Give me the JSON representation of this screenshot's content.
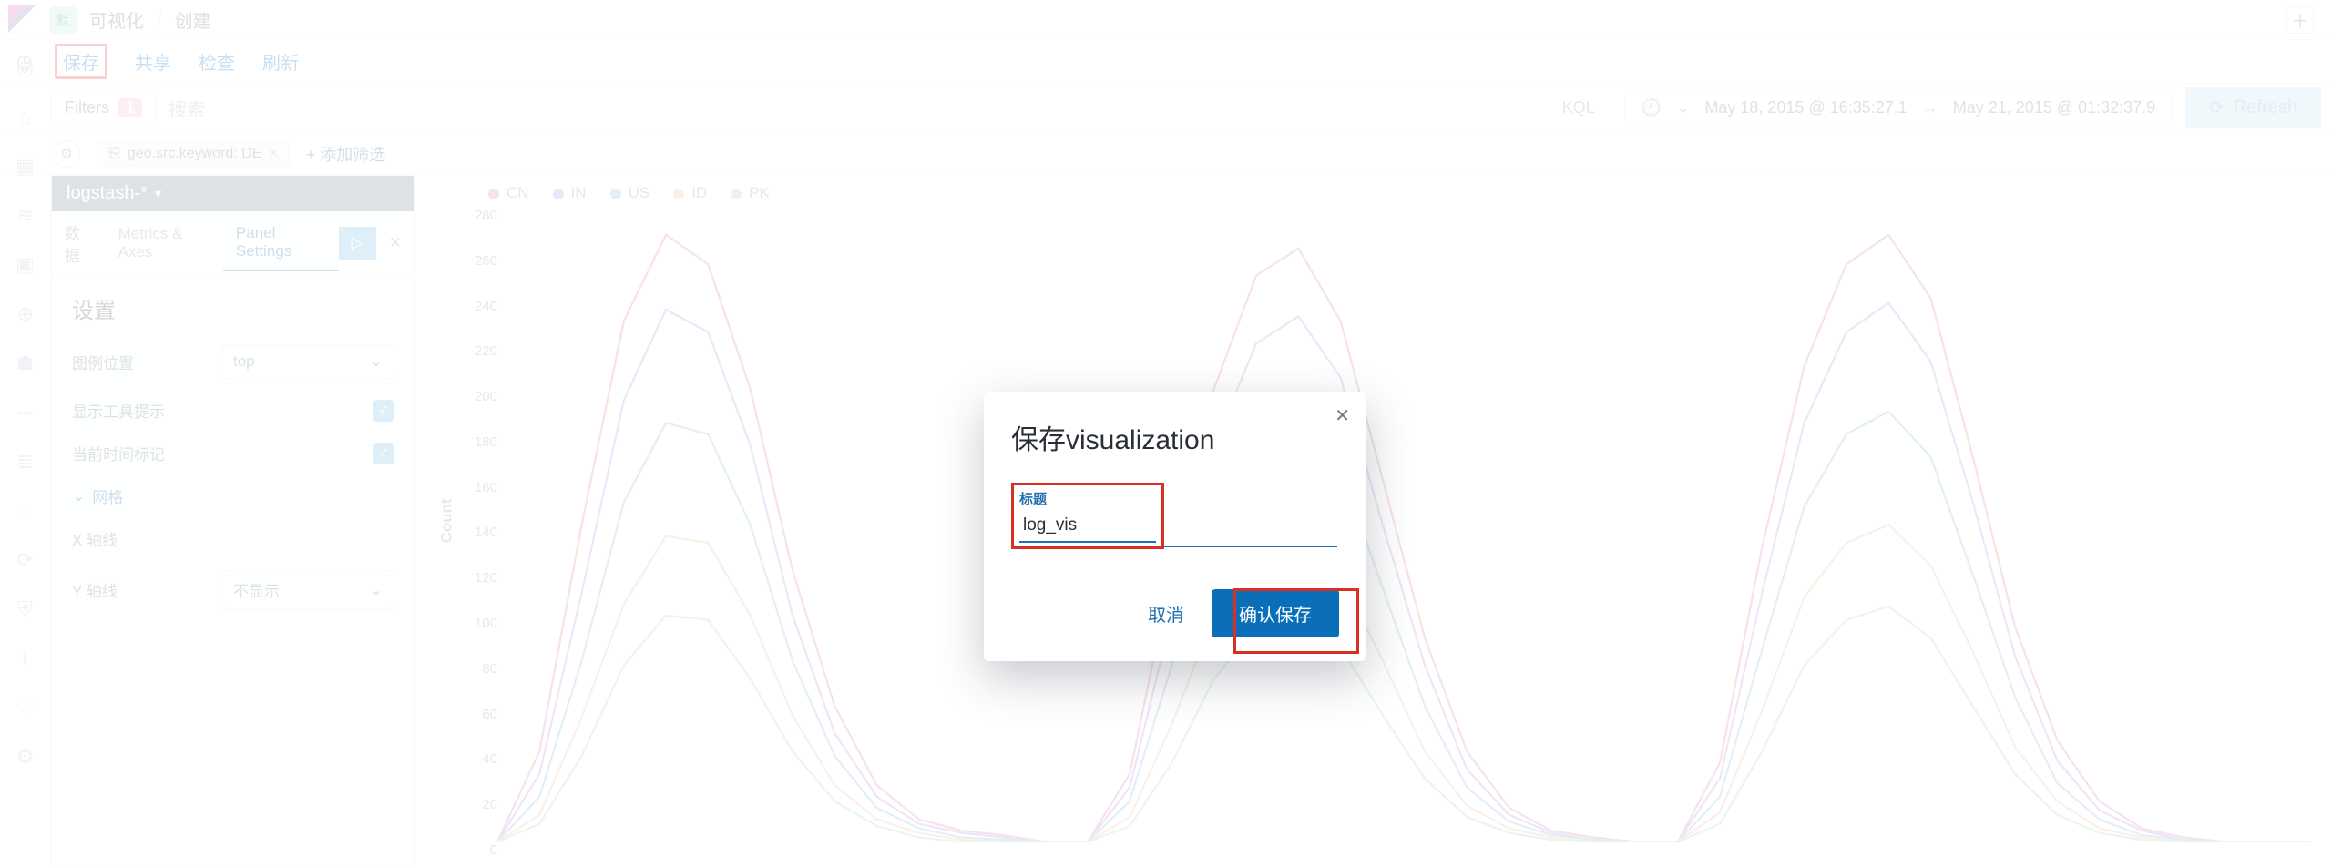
{
  "breadcrumb": {
    "env": "默",
    "vis": "可视化",
    "create": "创建"
  },
  "actions": {
    "save": "保存",
    "share": "共享",
    "inspect": "检查",
    "refresh": "刷新"
  },
  "query": {
    "filters_label": "Filters",
    "filters_count": "1",
    "search_placeholder": "搜索",
    "kql": "KQL",
    "date_from": "May 18, 2015 @ 16:35:27.1",
    "date_to": "May 21, 2015 @ 01:32:37.9",
    "refresh_btn": "Refresh"
  },
  "chips": {
    "chip1": "geo.src.keyword: DE",
    "add": "+ 添加筛选"
  },
  "cfg": {
    "index": "logstash-*",
    "tab_data": "数据",
    "tab_axes": "Metrics & Axes",
    "tab_panel": "Panel Settings",
    "heading": "设置",
    "legend_pos_label": "图例位置",
    "legend_pos_value": "top",
    "tooltip_label": "显示工具提示",
    "timecursor_label": "当前时间标记",
    "grid_label": "网格",
    "x_label": "X 轴线",
    "y_label": "Y 轴线",
    "y_value": "不显示"
  },
  "legend": {
    "s1": "CN",
    "s2": "IN",
    "s3": "US",
    "s4": "ID",
    "s5": "PK"
  },
  "yaxis": {
    "label": "Count",
    "ticks": [
      "280",
      "260",
      "240",
      "220",
      "200",
      "180",
      "160",
      "140",
      "120",
      "100",
      "80",
      "60",
      "40",
      "20",
      "0"
    ]
  },
  "modal": {
    "title": "保存visualization",
    "field_label": "标题",
    "value": "log_vis",
    "cancel": "取消",
    "confirm": "确认保存"
  },
  "chart_data": {
    "type": "line",
    "xlabel": "",
    "ylabel": "Count",
    "ylim": [
      0,
      280
    ],
    "note": "x is date-histogram buckets (≈3h) across May 18–21 2015; three diurnal peaks visible",
    "x": [
      0,
      1,
      2,
      3,
      4,
      5,
      6,
      7,
      8,
      9,
      10,
      11,
      12,
      13,
      14,
      15,
      16,
      17,
      18,
      19,
      20,
      21,
      22,
      23,
      24,
      25,
      26,
      27,
      28,
      29,
      30,
      31,
      32,
      33,
      34,
      35,
      36,
      37,
      38,
      39,
      40,
      41,
      42,
      43
    ],
    "series": [
      {
        "name": "CN",
        "color": "#e07a9b",
        "values": [
          0,
          40,
          140,
          230,
          268,
          255,
          200,
          120,
          60,
          25,
          10,
          5,
          3,
          0,
          0,
          30,
          120,
          200,
          250,
          262,
          230,
          160,
          90,
          40,
          15,
          5,
          2,
          0,
          0,
          35,
          130,
          210,
          255,
          268,
          240,
          170,
          95,
          45,
          18,
          6,
          2,
          0,
          0,
          0
        ]
      },
      {
        "name": "IN",
        "color": "#b18fe0",
        "values": [
          0,
          30,
          110,
          195,
          235,
          225,
          175,
          100,
          48,
          20,
          8,
          4,
          2,
          0,
          0,
          24,
          100,
          175,
          220,
          232,
          205,
          140,
          78,
          32,
          12,
          4,
          1,
          0,
          0,
          28,
          110,
          185,
          225,
          238,
          212,
          150,
          82,
          36,
          14,
          5,
          1,
          0,
          0,
          0
        ]
      },
      {
        "name": "US",
        "color": "#7bbad6",
        "values": [
          0,
          20,
          80,
          150,
          185,
          180,
          140,
          80,
          38,
          15,
          6,
          2,
          1,
          0,
          0,
          18,
          78,
          140,
          175,
          185,
          165,
          112,
          60,
          24,
          9,
          3,
          1,
          0,
          0,
          20,
          85,
          148,
          180,
          190,
          170,
          118,
          64,
          26,
          10,
          3,
          1,
          0,
          0,
          0
        ]
      },
      {
        "name": "ID",
        "color": "#e6b98f",
        "values": [
          0,
          12,
          55,
          105,
          135,
          132,
          100,
          56,
          25,
          10,
          4,
          1,
          0,
          0,
          0,
          11,
          52,
          100,
          128,
          135,
          118,
          80,
          40,
          16,
          6,
          2,
          0,
          0,
          0,
          13,
          58,
          108,
          132,
          140,
          122,
          84,
          42,
          18,
          6,
          2,
          0,
          0,
          0,
          0
        ]
      },
      {
        "name": "PK",
        "color": "#9bd6b3",
        "values": [
          0,
          8,
          38,
          78,
          100,
          98,
          72,
          40,
          18,
          7,
          2,
          0,
          0,
          0,
          0,
          7,
          35,
          72,
          95,
          100,
          86,
          56,
          28,
          11,
          4,
          1,
          0,
          0,
          0,
          8,
          40,
          78,
          98,
          104,
          90,
          60,
          30,
          12,
          4,
          1,
          0,
          0,
          0,
          0
        ]
      }
    ]
  }
}
